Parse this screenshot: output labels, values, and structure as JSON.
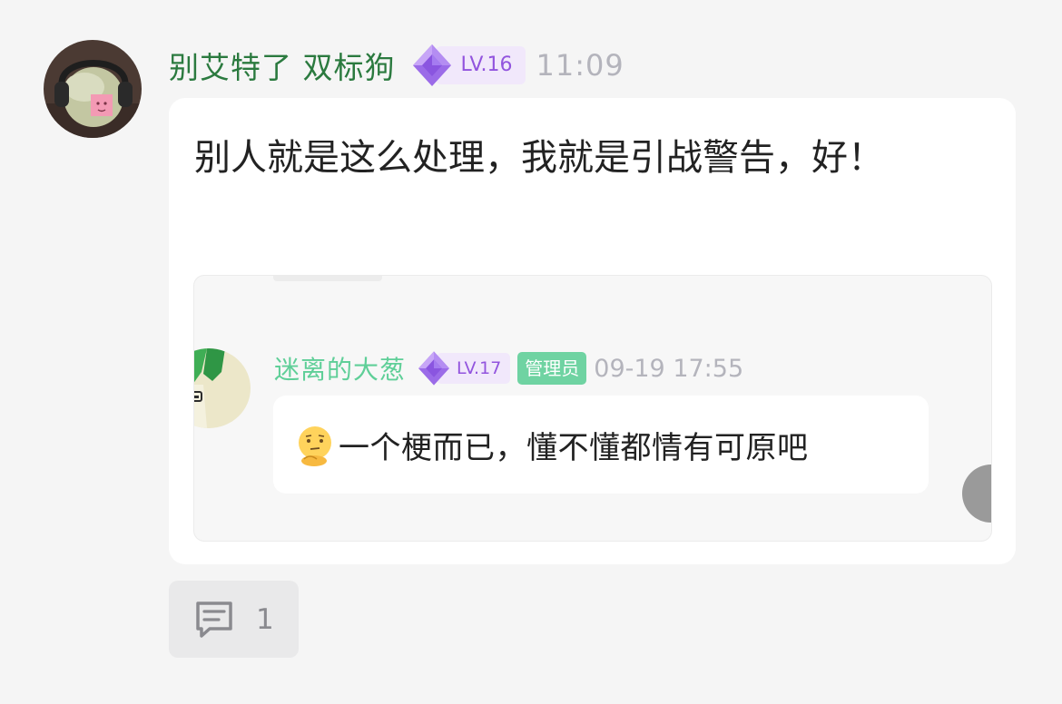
{
  "post": {
    "username": "别艾特了 双标狗",
    "level": "LV.16",
    "time": "11:09",
    "content": "别人就是这么处理，我就是引战警告，好！",
    "avatar_icon": "avatar-image"
  },
  "quote": {
    "username": "迷离的大葱",
    "level": "LV.17",
    "role_badge": "管理员",
    "time": "09-19 17:55",
    "emoji_icon": "thinking-face-emoji",
    "content": "一个梗而已，懂不懂都情有可原吧",
    "avatar_icon": "green-onion-avatar"
  },
  "actions": {
    "comment_icon": "comment-icon",
    "comment_count": "1"
  },
  "colors": {
    "username_green": "#2b7a3f",
    "quote_username_green": "#5fcf98",
    "level_purple": "#9254de",
    "level_bg": "#f1e8fb",
    "admin_badge_bg": "#6fd3a2",
    "timestamp_gray": "#b4b4bc",
    "page_bg": "#f5f5f5"
  }
}
